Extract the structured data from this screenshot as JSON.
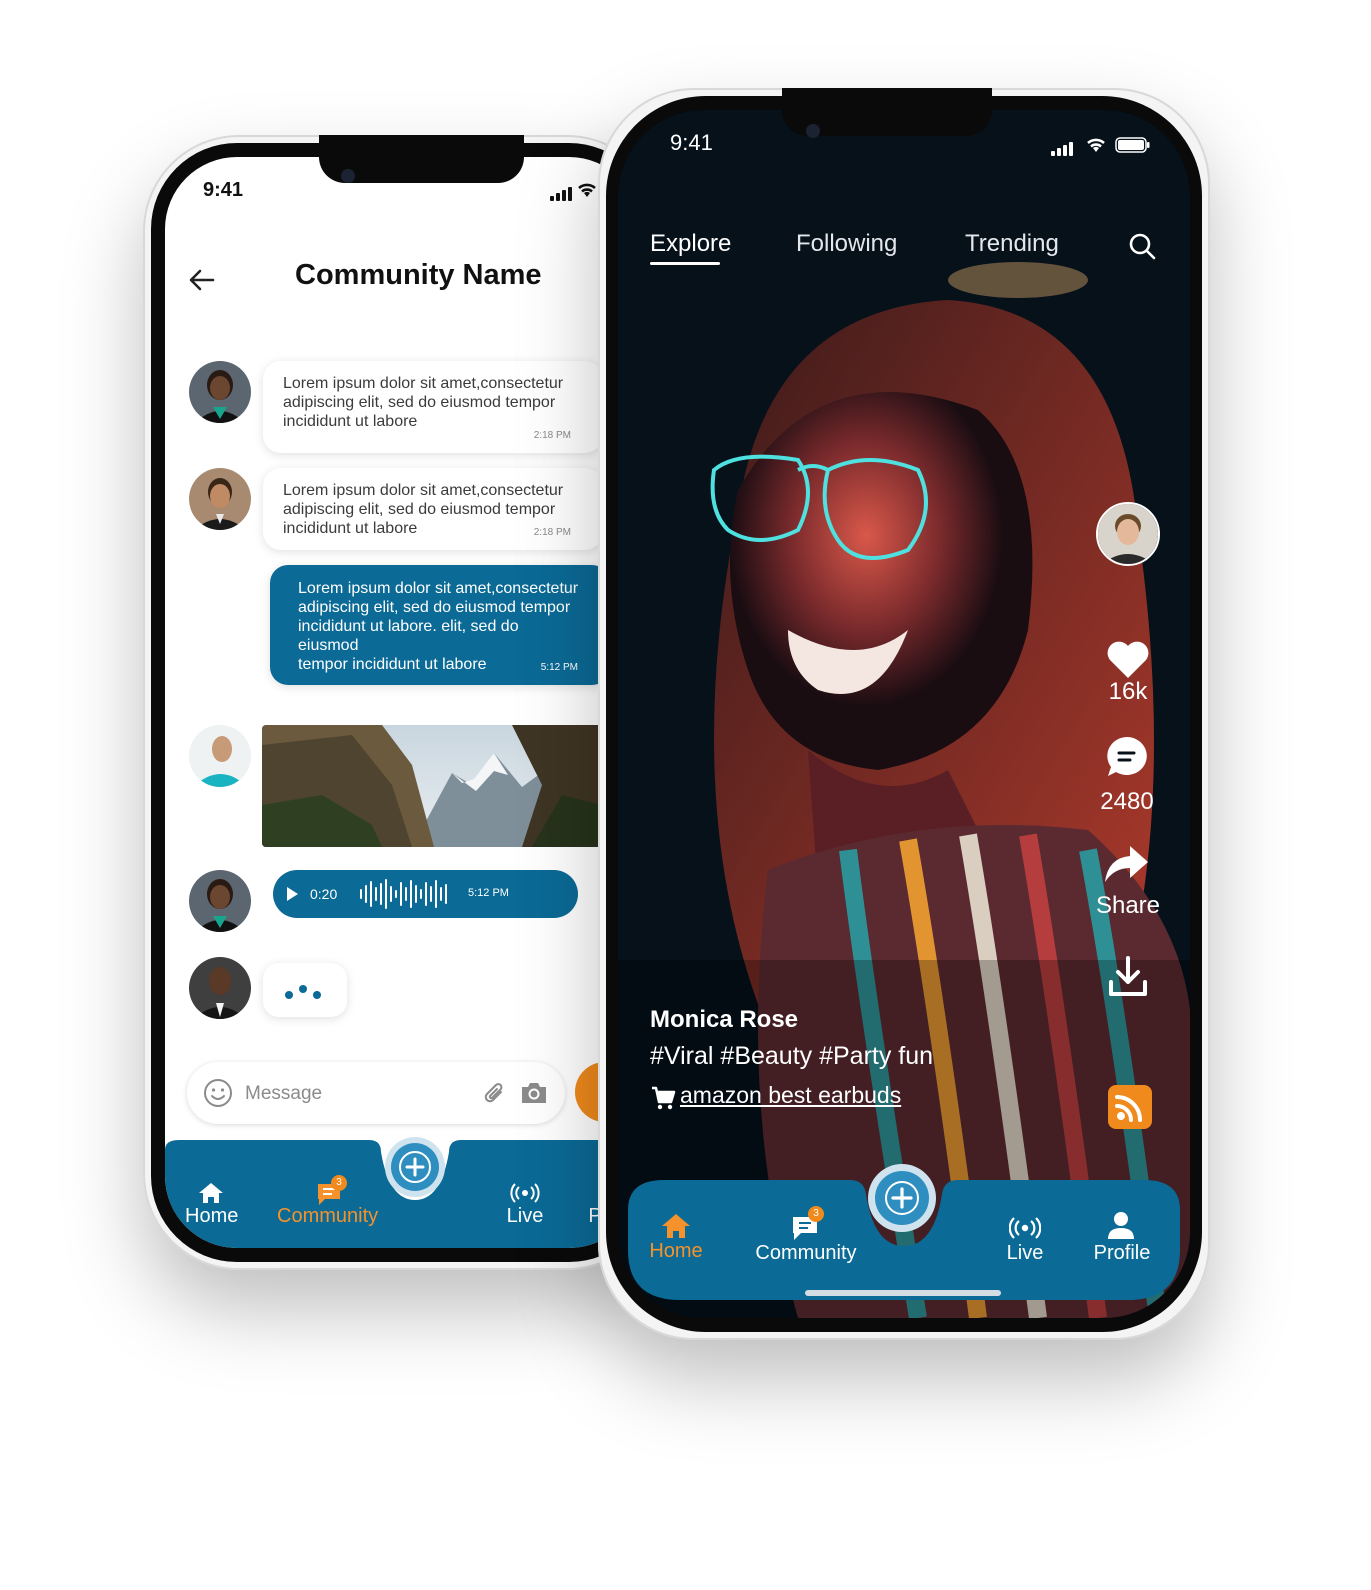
{
  "colors": {
    "brand_blue": "#0b6a96",
    "accent_orange": "#f5922b",
    "dark_bg": "#06111a"
  },
  "left_phone": {
    "status": {
      "time": "9:41"
    },
    "header": {
      "title": "Community Name",
      "back_icon": "arrow-left-icon"
    },
    "messages": [
      {
        "text": "Lorem ipsum dolor sit amet,consectetur\nadipiscing elit, sed do eiusmod tempor\n incididunt ut labore",
        "time": "2:18 PM"
      },
      {
        "text": "Lorem ipsum dolor sit amet,consectetur\nadipiscing elit, sed do eiusmod tempor\n incididunt ut labore",
        "time": "2:18 PM"
      },
      {
        "text": "Lorem ipsum dolor sit amet,consectetur\nadipiscing elit, sed do eiusmod tempor\n incididunt ut labore. elit, sed do eiusmod\ntempor incididunt ut labore",
        "time": "5:12 PM"
      }
    ],
    "voice_message": {
      "duration": "0:20",
      "time": "5:12 PM"
    },
    "input": {
      "placeholder": "Message"
    },
    "nav": {
      "home": "Home",
      "community": "Community",
      "live": "Live",
      "profile_partial": "P",
      "badge": "3"
    }
  },
  "right_phone": {
    "status": {
      "time": "9:41"
    },
    "tabs": [
      "Explore",
      "Following",
      "Trending"
    ],
    "actions": {
      "likes": "16k",
      "comments": "2480",
      "share": "Share"
    },
    "post": {
      "creator": "Monica Rose",
      "hashtags": "#Viral  #Beauty #Party fun",
      "product": "amazon best earbuds"
    },
    "nav": {
      "home": "Home",
      "community": "Community",
      "live": "Live",
      "profile": "Profile",
      "badge": "3"
    }
  }
}
